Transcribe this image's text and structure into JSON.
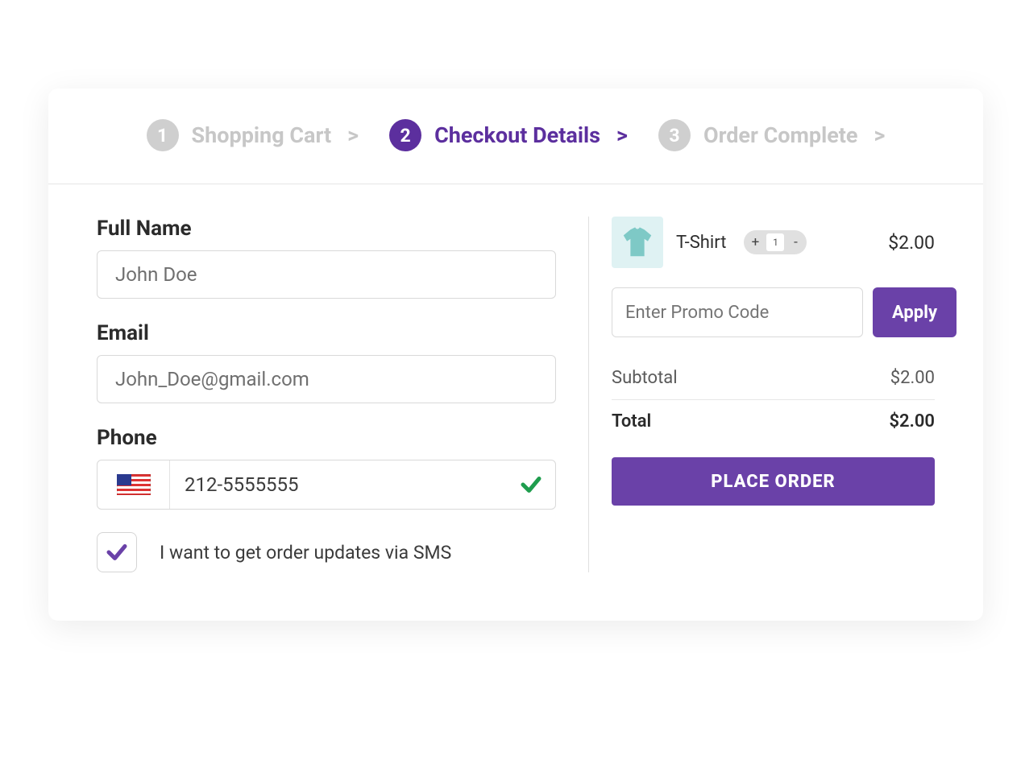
{
  "steps": [
    {
      "num": "1",
      "label": "Shopping Cart",
      "active": false
    },
    {
      "num": "2",
      "label": "Checkout Details",
      "active": true
    },
    {
      "num": "3",
      "label": "Order Complete",
      "active": false
    }
  ],
  "form": {
    "full_name_label": "Full Name",
    "full_name_value": "John Doe",
    "email_label": "Email",
    "email_value": "John_Doe@gmail.com",
    "phone_label": "Phone",
    "phone_value": "212-5555555",
    "phone_country": "US",
    "phone_valid": true,
    "sms_checked": true,
    "sms_label": "I want to get order updates via SMS"
  },
  "cart": {
    "items": [
      {
        "name": "T-Shirt",
        "qty": "1",
        "price": "$2.00"
      }
    ],
    "promo_placeholder": "Enter Promo Code",
    "apply_label": "Apply",
    "subtotal_label": "Subtotal",
    "subtotal_value": "$2.00",
    "total_label": "Total",
    "total_value": "$2.00",
    "place_order_label": "PLACE ORDER"
  },
  "colors": {
    "accent": "#6a41a8",
    "accent_dark": "#5c2f9e",
    "valid_green": "#1f9d4e"
  }
}
